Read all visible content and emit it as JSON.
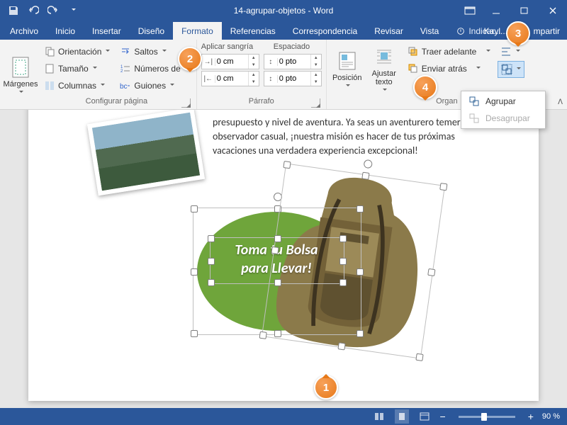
{
  "title": "14-agrupar-objetos - Word",
  "tabs": [
    "Archivo",
    "Inicio",
    "Insertar",
    "Diseño",
    "Formato",
    "Referencias",
    "Correspondencia",
    "Revisar",
    "Vista"
  ],
  "tell_me": "Indicar...",
  "account": "Kayl...",
  "share": "mpartir",
  "ribbon": {
    "margins": "Márgenes",
    "orientation": "Orientación",
    "size": "Tamaño",
    "columns": "Columnas",
    "breaks": "Saltos",
    "line_numbers": "Números de",
    "hyphenation": "Guiones",
    "group_page_setup": "Configurar página",
    "indent_header": "Aplicar sangría",
    "spacing_header": "Espaciado",
    "indent_left": "0 cm",
    "indent_right": "0 cm",
    "space_before": "0 pto",
    "space_after": "0 pto",
    "group_paragraph": "Párrafo",
    "position": "Posición",
    "wrap": "Ajustar texto",
    "bring_forward": "Traer adelante",
    "send_backward": "Enviar atrás",
    "group_arrange": "Organ"
  },
  "menu": {
    "group": "Agrupar",
    "ungroup": "Desagrupar"
  },
  "document": {
    "paragraph": "presupuesto y nivel de aventura. Ya seas un aventurero temerario o un observador casual, ¡nuestra misión es hacer de tus próximas vacaciones una verdadera experiencia excepcional!",
    "shape_text_l1": "Toma tu Bolsa",
    "shape_text_l2": "para Llevar!"
  },
  "callouts": [
    "1",
    "2",
    "3",
    "4"
  ],
  "status": {
    "zoom": "90 %"
  }
}
